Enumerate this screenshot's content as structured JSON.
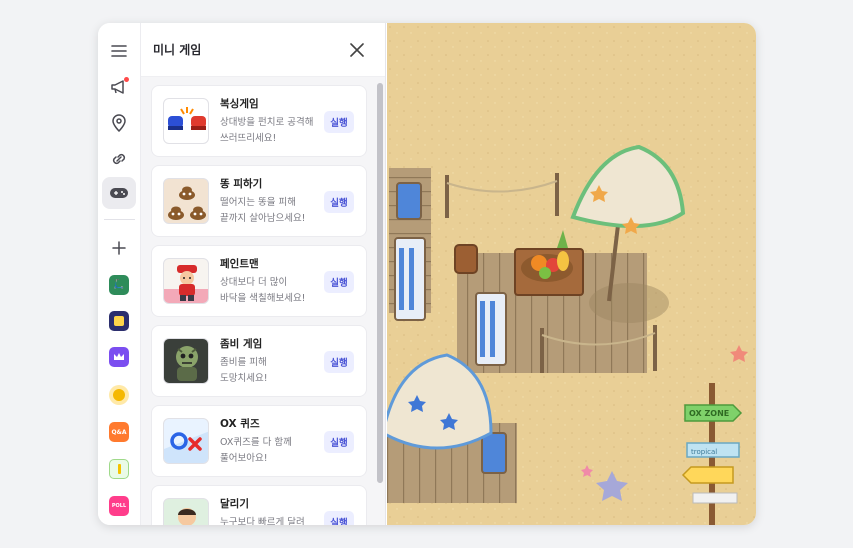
{
  "panel": {
    "title": "미니 게임",
    "run_label": "실행",
    "games": [
      {
        "title": "복싱게임",
        "desc": "상대방을 펀치로 공격해 쓰러뜨리세요!",
        "icon": "boxing-gloves-icon"
      },
      {
        "title": "똥 피하기",
        "desc": "떨어지는 똥을 피해 끝까지 살아남으세요!",
        "icon": "poop-icon"
      },
      {
        "title": "페인트맨",
        "desc": "상대보다 더 많이 바닥을 색칠해보세요!",
        "icon": "painter-icon"
      },
      {
        "title": "좀비 게임",
        "desc": "좀비를 피해 도망치세요!",
        "icon": "zombie-icon"
      },
      {
        "title": "OX 퀴즈",
        "desc": "OX퀴즈를 다 함께 풀어보아요!",
        "icon": "ox-quiz-icon"
      },
      {
        "title": "달리기",
        "desc": "누구보다 빠르게 달려",
        "icon": "runner-icon"
      }
    ]
  },
  "rail": {
    "icons": [
      "menu-icon",
      "megaphone-icon",
      "location-pin-icon",
      "link-icon",
      "gamepad-icon",
      "plus-icon"
    ],
    "app_labels": {
      "qna": "Q&A",
      "poll": "POLL"
    }
  },
  "map": {
    "signs": [
      "OX ZONE",
      "tropical"
    ]
  },
  "colors": {
    "accent": "#4b55d6",
    "accent_bg": "#eceeff",
    "sand": "#e9cf96"
  }
}
